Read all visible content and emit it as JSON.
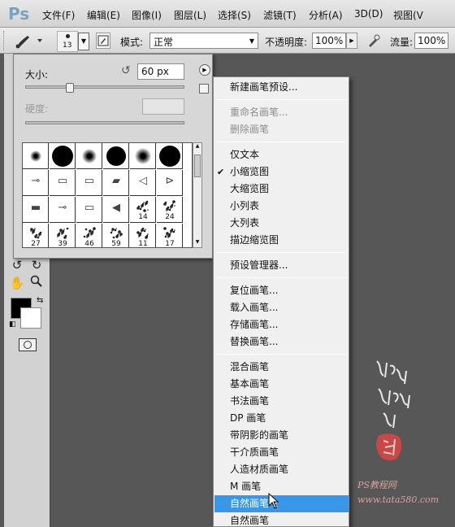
{
  "app": {
    "logo": "Ps"
  },
  "menubar": {
    "items": [
      "文件(F)",
      "编辑(E)",
      "图像(I)",
      "图层(L)",
      "选择(S)",
      "滤镜(T)",
      "分析(A)",
      "3D(D)",
      "视图(V"
    ]
  },
  "options_bar": {
    "brush_size": "13",
    "mode_label": "模式:",
    "mode_value": "正常",
    "opacity_label": "不透明度:",
    "opacity_value": "100%",
    "flow_label": "流量:",
    "flow_value": "100%"
  },
  "brush_panel": {
    "size_label": "大小:",
    "size_value": "60 px",
    "size_fraction": 0.28,
    "hardness_label": "硬度:",
    "brushes": [
      {
        "type": "soft",
        "d": 14
      },
      {
        "type": "hard",
        "d": 26
      },
      {
        "type": "soft",
        "d": 18
      },
      {
        "type": "hard",
        "d": 24
      },
      {
        "type": "soft",
        "d": 20
      },
      {
        "type": "hard",
        "d": 26
      },
      {
        "type": "tip",
        "glyph": "⊸"
      },
      {
        "type": "tip",
        "glyph": "▭"
      },
      {
        "type": "tip",
        "glyph": "▭"
      },
      {
        "type": "tip",
        "glyph": "▰"
      },
      {
        "type": "tip",
        "glyph": "◁"
      },
      {
        "type": "tip",
        "glyph": "⊳"
      },
      {
        "type": "tip",
        "glyph": "▬"
      },
      {
        "type": "tip",
        "glyph": "⊸"
      },
      {
        "type": "tip",
        "glyph": "▭"
      },
      {
        "type": "tip",
        "glyph": "◀"
      },
      {
        "type": "scatter",
        "num": "14"
      },
      {
        "type": "scatter",
        "num": "24"
      },
      {
        "type": "scatter",
        "num": "27"
      },
      {
        "type": "scatter",
        "num": "39"
      },
      {
        "type": "scatter",
        "num": "46"
      },
      {
        "type": "scatter",
        "num": "59"
      },
      {
        "type": "scatter",
        "num": "11"
      },
      {
        "type": "scatter",
        "num": "17"
      }
    ]
  },
  "context_menu": {
    "items": [
      {
        "label": "新建画笔预设...",
        "disabled": false,
        "checked": false,
        "highlighted": false
      },
      {
        "sep": true
      },
      {
        "label": "重命名画笔...",
        "disabled": true,
        "checked": false,
        "highlighted": false
      },
      {
        "label": "删除画笔",
        "disabled": true,
        "checked": false,
        "highlighted": false
      },
      {
        "sep": true
      },
      {
        "label": "仅文本",
        "disabled": false,
        "checked": false,
        "highlighted": false
      },
      {
        "label": "小缩览图",
        "disabled": false,
        "checked": true,
        "highlighted": false
      },
      {
        "label": "大缩览图",
        "disabled": false,
        "checked": false,
        "highlighted": false
      },
      {
        "label": "小列表",
        "disabled": false,
        "checked": false,
        "highlighted": false
      },
      {
        "label": "大列表",
        "disabled": false,
        "checked": false,
        "highlighted": false
      },
      {
        "label": "描边缩览图",
        "disabled": false,
        "checked": false,
        "highlighted": false
      },
      {
        "sep": true
      },
      {
        "label": "预设管理器...",
        "disabled": false,
        "checked": false,
        "highlighted": false
      },
      {
        "sep": true
      },
      {
        "label": "复位画笔...",
        "disabled": false,
        "checked": false,
        "highlighted": false
      },
      {
        "label": "载入画笔...",
        "disabled": false,
        "checked": false,
        "highlighted": false
      },
      {
        "label": "存储画笔...",
        "disabled": false,
        "checked": false,
        "highlighted": false
      },
      {
        "label": "替换画笔...",
        "disabled": false,
        "checked": false,
        "highlighted": false
      },
      {
        "sep": true
      },
      {
        "label": "混合画笔",
        "disabled": false,
        "checked": false,
        "highlighted": false
      },
      {
        "label": "基本画笔",
        "disabled": false,
        "checked": false,
        "highlighted": false
      },
      {
        "label": "书法画笔",
        "disabled": false,
        "checked": false,
        "highlighted": false
      },
      {
        "label": "DP 画笔",
        "disabled": false,
        "checked": false,
        "highlighted": false
      },
      {
        "label": "带阴影的画笔",
        "disabled": false,
        "checked": false,
        "highlighted": false
      },
      {
        "label": "干介质画笔",
        "disabled": false,
        "checked": false,
        "highlighted": false
      },
      {
        "label": "人造材质画笔",
        "disabled": false,
        "checked": false,
        "highlighted": false
      },
      {
        "label": "M 画笔",
        "disabled": false,
        "checked": false,
        "highlighted": false
      },
      {
        "label": "自然画笔 2",
        "disabled": false,
        "checked": false,
        "highlighted": true
      },
      {
        "label": "自然画笔",
        "disabled": false,
        "checked": false,
        "highlighted": false
      }
    ]
  },
  "watermark": {
    "site": "PS教程网",
    "url": "www.tata580.com"
  },
  "colors": {
    "menu_highlight": "#3a97e8",
    "foreground": "#000000",
    "background": "#ffffff"
  }
}
